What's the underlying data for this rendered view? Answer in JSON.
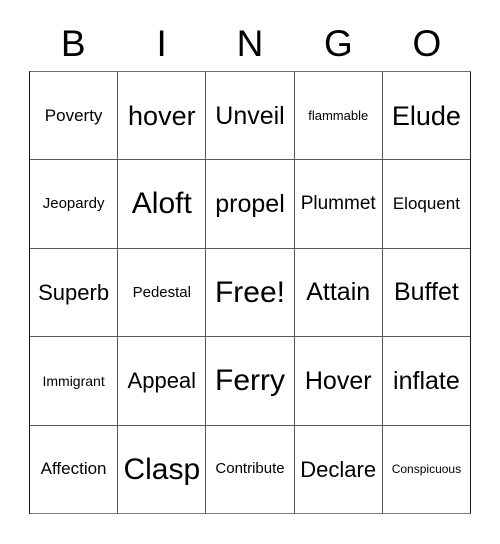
{
  "header": {
    "letters": [
      "B",
      "I",
      "N",
      "G",
      "O"
    ]
  },
  "grid": {
    "rows": 5,
    "columns": 5,
    "free_space": "Free!",
    "cells": [
      [
        {
          "label": "Poverty",
          "size": "mdp"
        },
        {
          "label": "hover",
          "size": "3xl"
        },
        {
          "label": "Unveil",
          "size": "2xl"
        },
        {
          "label": "flammable",
          "size": "sm"
        },
        {
          "label": "Elude",
          "size": "3xl"
        }
      ],
      [
        {
          "label": "Jeopardy",
          "size": "md"
        },
        {
          "label": "Aloft",
          "size": "4xl"
        },
        {
          "label": "propel",
          "size": "2xl"
        },
        {
          "label": "Plummet",
          "size": "lg"
        },
        {
          "label": "Eloquent",
          "size": "mdp"
        }
      ],
      [
        {
          "label": "Superb",
          "size": "xl"
        },
        {
          "label": "Pedestal",
          "size": "md"
        },
        {
          "label": "Free!",
          "size": "4xl"
        },
        {
          "label": "Attain",
          "size": "2xl"
        },
        {
          "label": "Buffet",
          "size": "2xl"
        }
      ],
      [
        {
          "label": "Immigrant",
          "size": "smp"
        },
        {
          "label": "Appeal",
          "size": "xl"
        },
        {
          "label": "Ferry",
          "size": "4xl"
        },
        {
          "label": "Hover",
          "size": "2xl"
        },
        {
          "label": "inflate",
          "size": "2xl"
        }
      ],
      [
        {
          "label": "Affection",
          "size": "mdp"
        },
        {
          "label": "Clasp",
          "size": "4xl"
        },
        {
          "label": "Contribute",
          "size": "md"
        },
        {
          "label": "Declare",
          "size": "xl"
        },
        {
          "label": "Conspicuous",
          "size": "xs"
        }
      ]
    ]
  },
  "colors": {
    "background": "#ffffff",
    "text": "#000000",
    "grid_line": "#5a5a5a",
    "grid_border": "#1a1a1a"
  }
}
